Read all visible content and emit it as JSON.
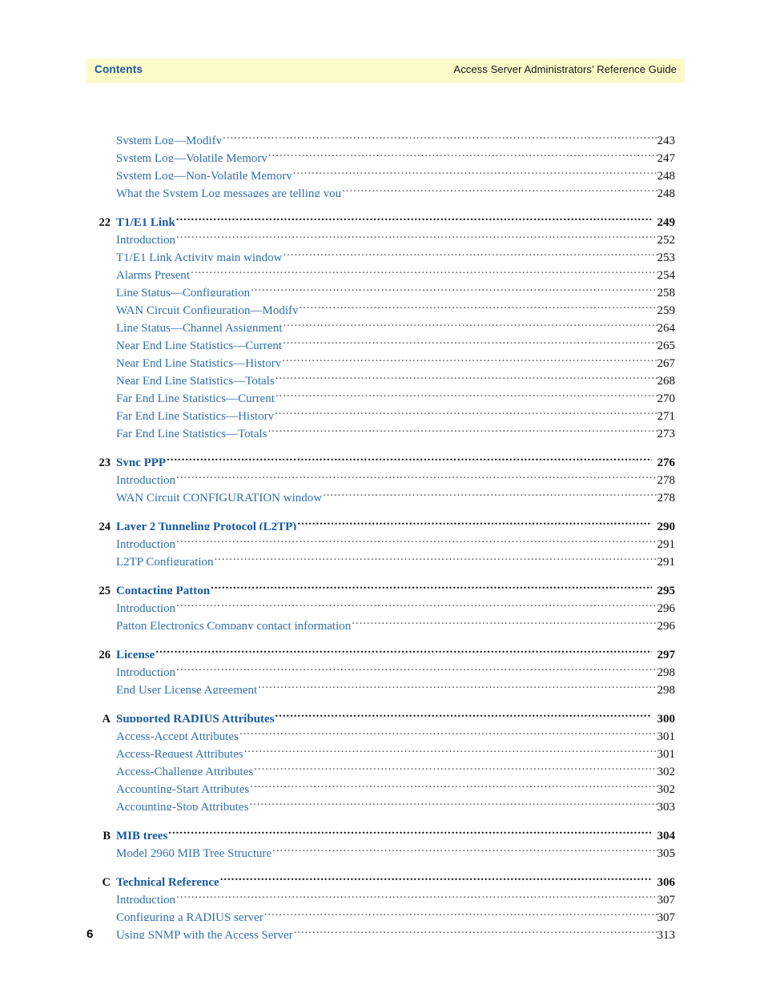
{
  "header": {
    "left_label": "Contents",
    "right_label": "Access Server Administrators’ Reference Guide",
    "band_color": "#fcfac8",
    "left_color": "#1559a6",
    "right_color": "#16171a"
  },
  "folio": {
    "page_number": "6"
  },
  "colors": {
    "chapter_blue": "#1559a6",
    "entry_blue": "#2f6fad",
    "number_black": "#111111",
    "leader_gray": "#5a5a5a"
  },
  "toc": {
    "entries": [
      {
        "number": "",
        "title": "System Log—Modify",
        "page": "243",
        "level": "entry"
      },
      {
        "number": "",
        "title": "System Log—Volatile Memory",
        "page": "247",
        "level": "entry"
      },
      {
        "number": "",
        "title": "System Log—Non-Volatile Memory",
        "page": "248",
        "level": "entry"
      },
      {
        "number": "",
        "title": "What the System Log messages are telling you",
        "page": "248",
        "level": "entry"
      },
      {
        "number": "22",
        "title": "T1/E1 Link",
        "page": "249",
        "level": "chapter"
      },
      {
        "number": "",
        "title": "Introduction",
        "page": "252",
        "level": "entry"
      },
      {
        "number": "",
        "title": "T1/E1 Link Activity main window",
        "page": "253",
        "level": "entry"
      },
      {
        "number": "",
        "title": "Alarms Present",
        "page": "254",
        "level": "entry"
      },
      {
        "number": "",
        "title": "Line Status—Configuration",
        "page": "258",
        "level": "entry"
      },
      {
        "number": "",
        "title": "WAN Circuit Configuration—Modify",
        "page": "259",
        "level": "entry"
      },
      {
        "number": "",
        "title": "Line Status—Channel Assignment",
        "page": "264",
        "level": "entry"
      },
      {
        "number": "",
        "title": "Near End Line Statistics—Current",
        "page": "265",
        "level": "entry"
      },
      {
        "number": "",
        "title": "Near End Line Statistics—History",
        "page": "267",
        "level": "entry"
      },
      {
        "number": "",
        "title": "Near End Line Statistics—Totals",
        "page": "268",
        "level": "entry"
      },
      {
        "number": "",
        "title": "Far End Line Statistics—Current",
        "page": "270",
        "level": "entry"
      },
      {
        "number": "",
        "title": "Far End Line Statistics—History",
        "page": "271",
        "level": "entry"
      },
      {
        "number": "",
        "title": "Far End Line Statistics—Totals",
        "page": "273",
        "level": "entry"
      },
      {
        "number": "23",
        "title": "Sync PPP",
        "page": "276",
        "level": "chapter"
      },
      {
        "number": "",
        "title": "Introduction",
        "page": "278",
        "level": "entry"
      },
      {
        "number": "",
        "title": "WAN Circuit CONFIGURATION window",
        "page": "278",
        "level": "entry"
      },
      {
        "number": "24",
        "title": "Layer 2 Tunneling Protocol (L2TP)",
        "page": "290",
        "level": "chapter"
      },
      {
        "number": "",
        "title": "Introduction",
        "page": "291",
        "level": "entry"
      },
      {
        "number": "",
        "title": "L2TP Configuration",
        "page": "291",
        "level": "entry"
      },
      {
        "number": "25",
        "title": "Contacting Patton",
        "page": "295",
        "level": "chapter"
      },
      {
        "number": "",
        "title": "Introduction",
        "page": "296",
        "level": "entry"
      },
      {
        "number": "",
        "title": "Patton Electronics Company contact information",
        "page": "296",
        "level": "entry"
      },
      {
        "number": "26",
        "title": "License",
        "page": "297",
        "level": "chapter"
      },
      {
        "number": "",
        "title": "Introduction",
        "page": "298",
        "level": "entry"
      },
      {
        "number": "",
        "title": "End User License Agreement",
        "page": "298",
        "level": "entry"
      },
      {
        "number": "A",
        "title": "Supported RADIUS Attributes",
        "page": "300",
        "level": "chapter"
      },
      {
        "number": "",
        "title": "Access-Accept Attributes",
        "page": "301",
        "level": "entry"
      },
      {
        "number": "",
        "title": "Access-Request Attributes",
        "page": "301",
        "level": "entry"
      },
      {
        "number": "",
        "title": "Access-Challenge Attributes",
        "page": "302",
        "level": "entry"
      },
      {
        "number": "",
        "title": "Accounting-Start Attributes",
        "page": "302",
        "level": "entry"
      },
      {
        "number": "",
        "title": "Accounting-Stop Attributes",
        "page": "303",
        "level": "entry"
      },
      {
        "number": "B",
        "title": "MIB trees",
        "page": "304",
        "level": "chapter"
      },
      {
        "number": "",
        "title": "Model 2960 MIB Tree Structure",
        "page": "305",
        "level": "entry"
      },
      {
        "number": "C",
        "title": "Technical Reference",
        "page": "306",
        "level": "chapter"
      },
      {
        "number": "",
        "title": "Introduction",
        "page": "307",
        "level": "entry"
      },
      {
        "number": "",
        "title": "Configuring a RADIUS server",
        "page": "307",
        "level": "entry"
      },
      {
        "number": "",
        "title": "Using SNMP with the Access Server",
        "page": "313",
        "level": "entry"
      }
    ]
  }
}
